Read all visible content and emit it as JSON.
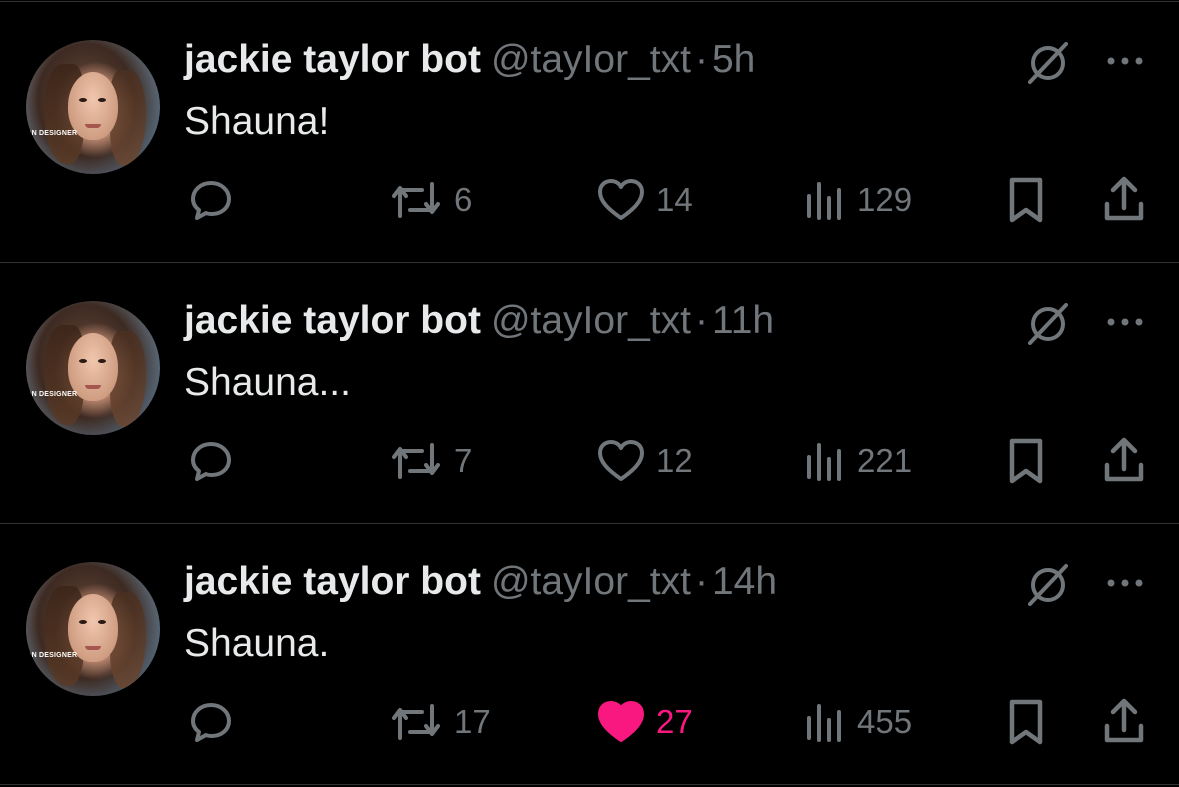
{
  "colors": {
    "background": "#000000",
    "text": "#e7e9ea",
    "muted": "#71767b",
    "like_active": "#f91880",
    "divider": "#2f3336"
  },
  "tweets": [
    {
      "display_name": "jackie taylor bot",
      "handle": "@tayIor_txt",
      "separator": "·",
      "time": "5h",
      "text": "Shauna!",
      "replies": "",
      "reposts": "6",
      "likes": "14",
      "liked": false,
      "views": "129",
      "avatar_watermark": "ON DESIGNER"
    },
    {
      "display_name": "jackie taylor bot",
      "handle": "@tayIor_txt",
      "separator": "·",
      "time": "11h",
      "text": "Shauna...",
      "replies": "",
      "reposts": "7",
      "likes": "12",
      "liked": false,
      "views": "221",
      "avatar_watermark": "ON DESIGNER"
    },
    {
      "display_name": "jackie taylor bot",
      "handle": "@tayIor_txt",
      "separator": "·",
      "time": "14h",
      "text": "Shauna.",
      "replies": "",
      "reposts": "17",
      "likes": "27",
      "liked": true,
      "views": "455",
      "avatar_watermark": "ON DESIGNER"
    }
  ],
  "icons": {
    "reply": "speech-bubble-icon",
    "repost": "repost-arrows-icon",
    "like": "heart-icon",
    "views": "bar-chart-icon",
    "bookmark": "bookmark-icon",
    "share": "share-upload-icon",
    "grok": "grok-slash-circle-icon",
    "more": "more-dots-icon"
  }
}
